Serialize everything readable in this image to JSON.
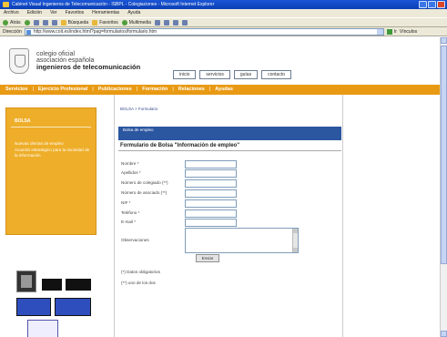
{
  "window": {
    "title": "Cabinet Visual Ingenieros de Telecomunicación - ISBPL - Colegiaciones - Microsoft Internet Explorer"
  },
  "menubar": {
    "items": [
      "Archivo",
      "Edición",
      "Ver",
      "Favoritos",
      "Herramientas",
      "Ayuda"
    ]
  },
  "toolbar": {
    "back_label": "Atrás",
    "search_label": "Búsqueda",
    "favorites_label": "Favoritos",
    "media_label": "Multimedia"
  },
  "address": {
    "label": "Dirección",
    "url": "http://www.coit.es/index.html?pag=formularios/formulario.htm",
    "go_label": "Ir",
    "links_label": "Vínculos"
  },
  "header": {
    "org_line1": "colegio oficial",
    "org_line2": "asociación española",
    "org_line3": "ingenieros de telecomunicación",
    "links": [
      "inicio",
      "servicios",
      "guías",
      "contacto"
    ]
  },
  "nav": {
    "items": [
      "Servicios",
      "Ejercicio Profesional",
      "Publicaciones",
      "Formación",
      "Relaciones",
      "Ayudas"
    ]
  },
  "sidebar": {
    "title": "BOLSA",
    "links": [
      "Nuevas ofertas de empleo",
      "Acuerdo estratégico para la sociedad de la información"
    ]
  },
  "content": {
    "breadcrumb": "BOLSA > Formulario",
    "section_title": "Bolsa de empleo",
    "form_title": "Formulario de Bolsa \"Información de empleo\"",
    "fields": [
      {
        "label": "Nombre *"
      },
      {
        "label": "Apellidos *"
      },
      {
        "label": "Número de colegiado (**)"
      },
      {
        "label": "Número de asociado (**)"
      },
      {
        "label": "NIF *"
      },
      {
        "label": "Teléfono *"
      },
      {
        "label": "E-mail *"
      }
    ],
    "observations_label": "Observaciones",
    "submit_label": "Enviar",
    "note1": "(*) Datos obligatorios",
    "note2": "(**) uno de los dos"
  }
}
